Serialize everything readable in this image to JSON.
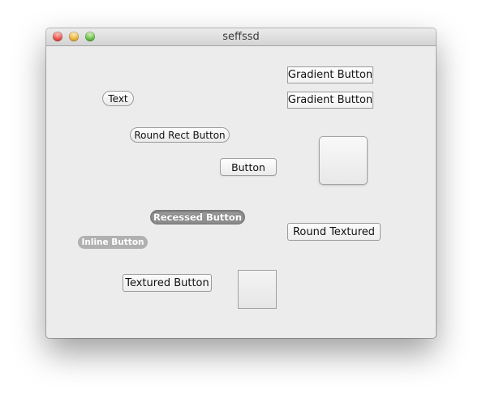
{
  "window": {
    "title": "seffssd",
    "controls": {
      "close": "close-button",
      "minimize": "minimize-button",
      "zoom": "zoom-button"
    }
  },
  "buttons": {
    "gradient_1": "Gradient Button",
    "gradient_2": "Gradient Button",
    "text_pill": "Text",
    "round_rect": "Round Rect Button",
    "push": "Button",
    "recessed": "Recessed Button",
    "inline": "Inline Button",
    "round_textured": "Round Textured",
    "textured": "Textured Button"
  }
}
